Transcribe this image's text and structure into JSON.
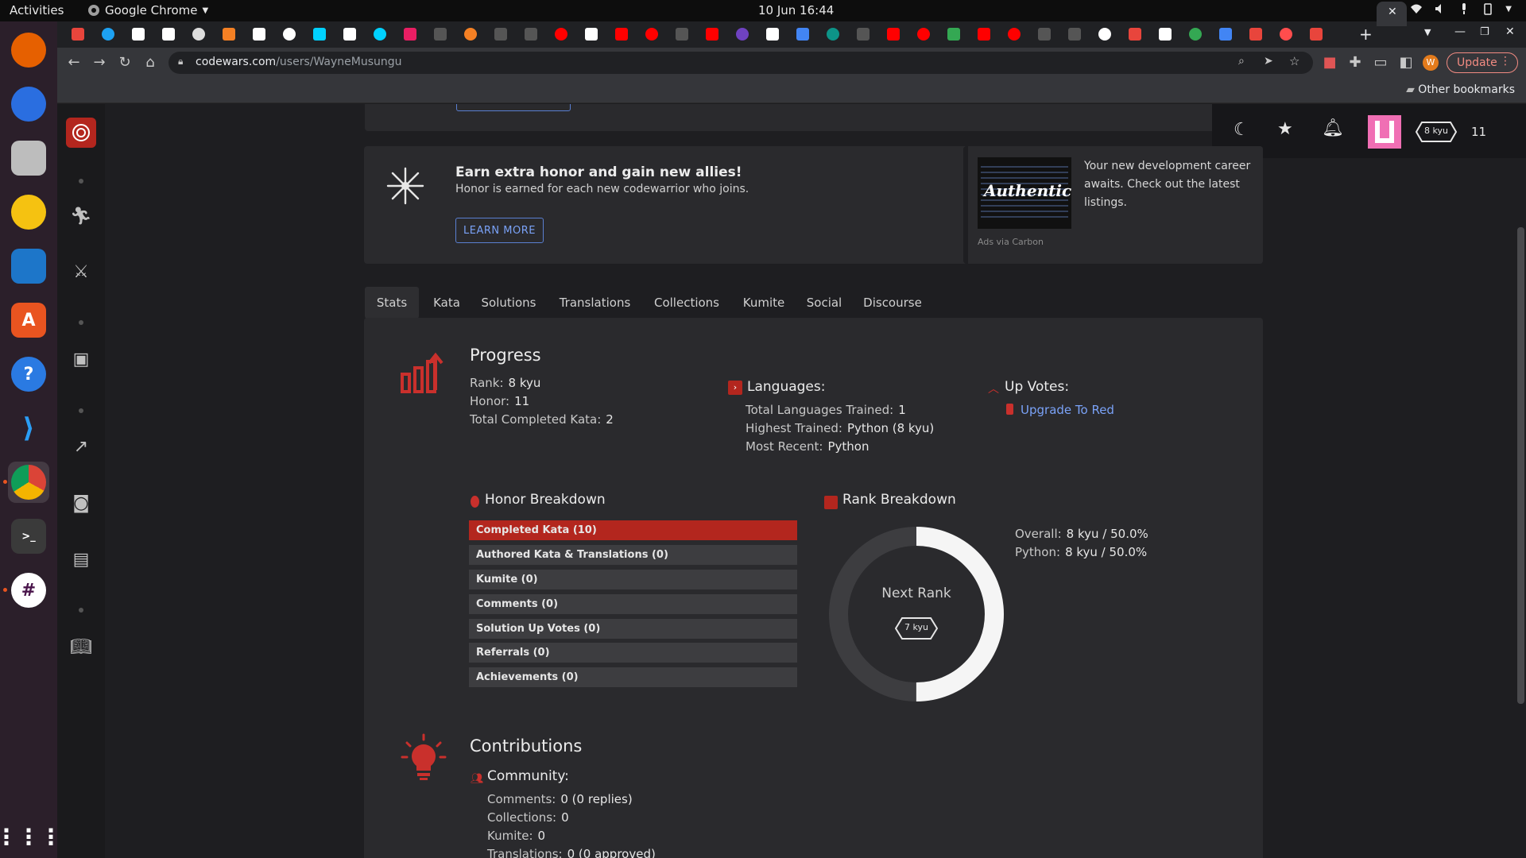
{
  "system": {
    "activities": "Activities",
    "app_menu": "Google Chrome",
    "clock": "10 Jun  16:44"
  },
  "browser": {
    "url_host": "codewars.com",
    "url_path": "/users/WayneMusungu",
    "update_label": "Update",
    "other_bookmarks": "Other bookmarks",
    "profile_initial": "W"
  },
  "topuser": {
    "rank_badge": "8 kyu",
    "honor": "11"
  },
  "promo": {
    "title": "Earn extra honor and gain new allies!",
    "text": "Honor is earned for each new codewarrior who joins.",
    "button": "LEARN MORE"
  },
  "ad": {
    "text": "Your new development career awaits. Check out the latest listings.",
    "image_text": "Authentic",
    "via": "Ads via Carbon"
  },
  "tabs": [
    "Stats",
    "Kata",
    "Solutions",
    "Translations",
    "Collections",
    "Kumite",
    "Social",
    "Discourse"
  ],
  "progress": {
    "title": "Progress",
    "rank_label": "Rank:",
    "rank_value": "8 kyu",
    "honor_label": "Honor:",
    "honor_value": "11",
    "completed_label": "Total Completed Kata:",
    "completed_value": "2"
  },
  "languages": {
    "title": "Languages:",
    "trained_label": "Total Languages Trained:",
    "trained_value": "1",
    "highest_label": "Highest Trained:",
    "highest_value": "Python (8 kyu)",
    "recent_label": "Most Recent:",
    "recent_value": "Python"
  },
  "upvotes": {
    "title": "Up Votes:",
    "link": "Upgrade To Red"
  },
  "honor_breakdown": {
    "title": "Honor Breakdown",
    "rows": [
      "Completed Kata (10)",
      "Authored Kata & Translations (0)",
      "Kumite (0)",
      "Comments (0)",
      "Solution Up Votes (0)",
      "Referrals (0)",
      "Achievements (0)"
    ]
  },
  "rank_breakdown": {
    "title": "Rank Breakdown",
    "center_label": "Next Rank",
    "next_rank": "7 kyu",
    "progress_fraction": 0.5,
    "overall_label": "Overall:",
    "overall_value": "8 kyu / 50.0%",
    "python_label": "Python:",
    "python_value": "8 kyu / 50.0%"
  },
  "contributions": {
    "title": "Contributions",
    "community_title": "Community:",
    "comments_label": "Comments:",
    "comments_value": "0 (0 replies)",
    "collections_label": "Collections:",
    "collections_value": "0",
    "kumite_label": "Kumite:",
    "kumite_value": "0",
    "translations_label": "Translations:",
    "translations_value": "0 (0 approved)"
  },
  "colors": {
    "accent_red": "#b3261e",
    "link_blue": "#7aa2f7",
    "ring_fill": "#f5f5f5",
    "ring_track": "#3d3d40"
  }
}
